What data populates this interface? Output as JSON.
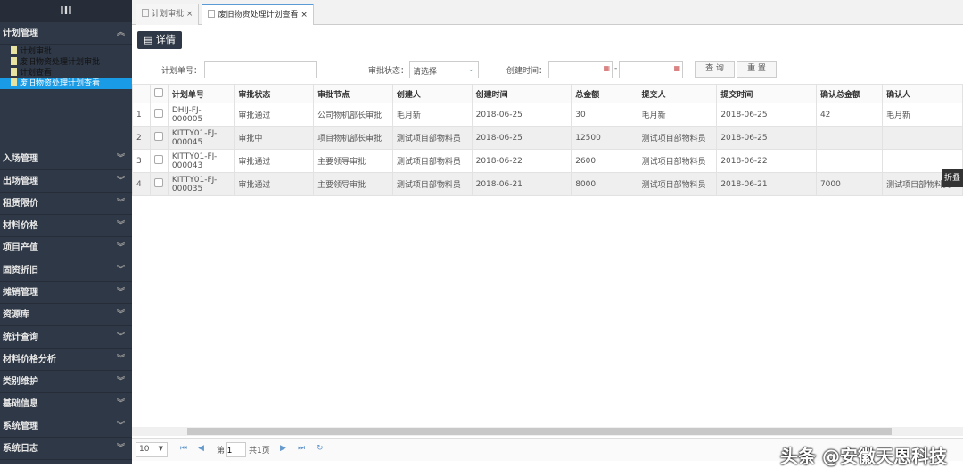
{
  "sidebar": {
    "toggle": "III",
    "open_group": "计划管理",
    "sub_items": [
      "计划审批",
      "废旧物资处理计划审批",
      "计划查看",
      "废旧物资处理计划查看"
    ],
    "groups": [
      "入场管理",
      "出场管理",
      "租赁限价",
      "材料价格",
      "项目产值",
      "固资折旧",
      "摊销管理",
      "资源库",
      "统计查询",
      "材料价格分析",
      "类别维护",
      "基础信息",
      "系统管理",
      "系统日志"
    ]
  },
  "tabs": [
    {
      "label": "计划审批",
      "close": "×"
    },
    {
      "label": "废旧物资处理计划查看",
      "close": "×"
    }
  ],
  "toolbar": {
    "detail": "详情"
  },
  "filters": {
    "plan_no_label": "计划单号：",
    "plan_no_value": "",
    "status_label": "审批状态：",
    "status_value": "请选择",
    "created_label": "创建时间：",
    "date_sep": "-",
    "query": "查 询",
    "reset": "重 置"
  },
  "table": {
    "headers": [
      "计划单号",
      "审批状态",
      "审批节点",
      "创建人",
      "创建时间",
      "总金额",
      "提交人",
      "提交时间",
      "确认总金额",
      "确认人"
    ],
    "rows": [
      {
        "idx": "1",
        "cells": [
          "DHIJ-FJ-000005",
          "审批通过",
          "公司物机部长审批",
          "毛月新",
          "2018-06-25",
          "30",
          "毛月新",
          "2018-06-25",
          "42",
          "毛月新"
        ]
      },
      {
        "idx": "2",
        "cells": [
          "KITTY01-FJ-000045",
          "审批中",
          "项目物机部长审批",
          "测试项目部物料员",
          "2018-06-25",
          "12500",
          "测试项目部物料员",
          "2018-06-25",
          "",
          ""
        ]
      },
      {
        "idx": "3",
        "cells": [
          "KITTY01-FJ-000043",
          "审批通过",
          "主要领导审批",
          "测试项目部物料员",
          "2018-06-22",
          "2600",
          "测试项目部物料员",
          "2018-06-22",
          "",
          ""
        ]
      },
      {
        "idx": "4",
        "cells": [
          "KITTY01-FJ-000035",
          "审批通过",
          "主要领导审批",
          "测试项目部物料员",
          "2018-06-21",
          "8000",
          "测试项目部物料员",
          "2018-06-21",
          "7000",
          "测试项目部物料员"
        ]
      }
    ]
  },
  "fold": "折叠",
  "pager": {
    "page_size": "10",
    "page_prefix": "第",
    "page": "1",
    "total": "共1页"
  },
  "watermark": "头条 @安徽天恩科技"
}
